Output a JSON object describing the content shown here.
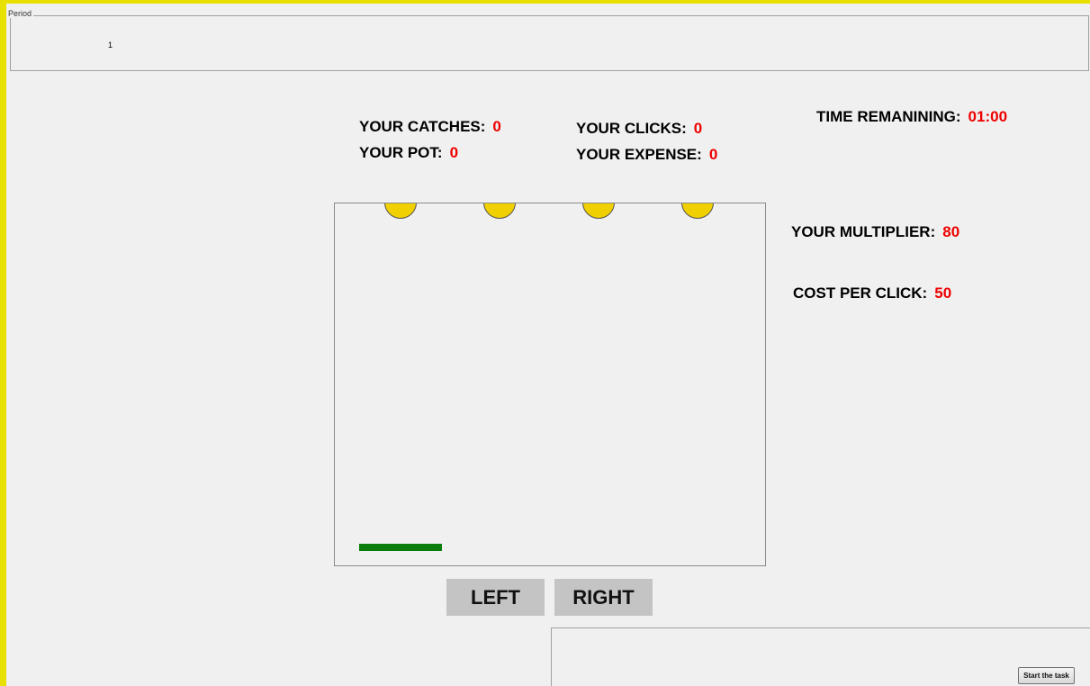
{
  "period": {
    "legend": "Period",
    "value": "1"
  },
  "stats": {
    "catches_label": "YOUR CATCHES:",
    "catches_value": "0",
    "clicks_label": "YOUR CLICKS:",
    "clicks_value": "0",
    "pot_label": "YOUR POT:",
    "pot_value": "0",
    "expense_label": "YOUR EXPENSE:",
    "expense_value": "0",
    "time_label": "TIME REMANINING:",
    "time_value": "01:00",
    "multiplier_label": "YOUR MULTIPLIER:",
    "multiplier_value": "80",
    "cost_label": "COST PER CLICK:",
    "cost_value": "50"
  },
  "game": {
    "ball_color": "#f0d000",
    "paddle_color": "#0a7d0a",
    "ball_count": 4
  },
  "controls": {
    "left_label": "LEFT",
    "right_label": "RIGHT",
    "start_label": "Start the task"
  },
  "colors": {
    "frame_accent": "#e8e000",
    "value_red": "#ee0000"
  }
}
